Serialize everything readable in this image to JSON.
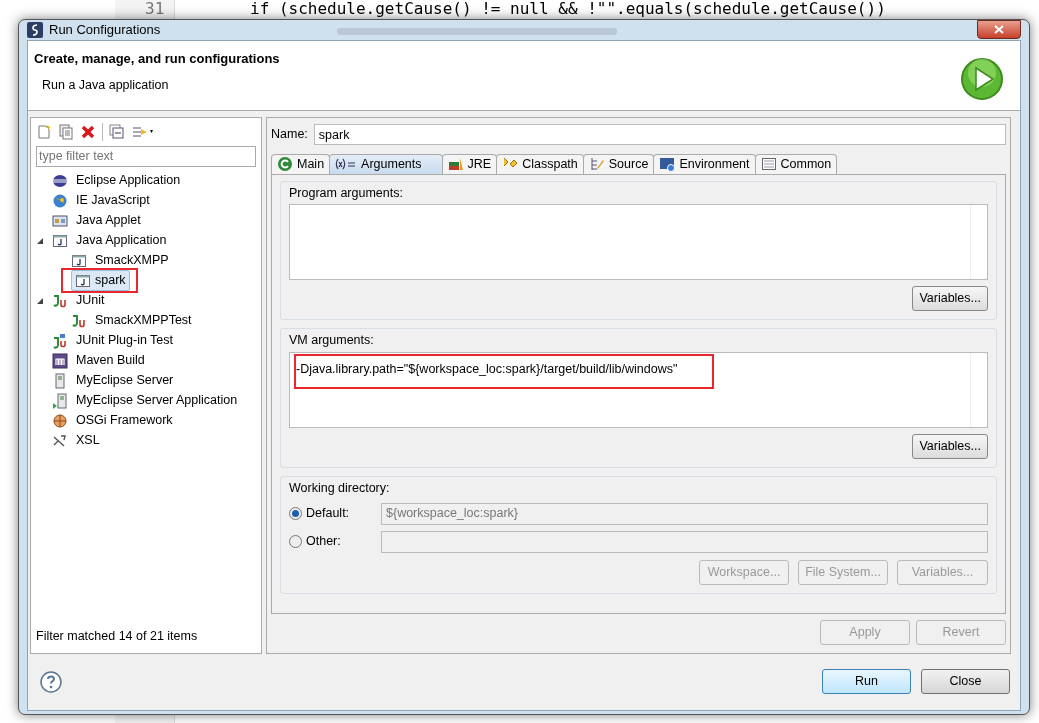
{
  "editor": {
    "line_number": "31",
    "code": "if (schedule.getCause() != null && !\"\".equals(schedule.getCause())"
  },
  "window": {
    "title": "Run Configurations"
  },
  "header": {
    "title": "Create, manage, and run configurations",
    "subtitle": "Run a Java application"
  },
  "filter": {
    "placeholder": "type filter text"
  },
  "tree": [
    {
      "label": "Eclipse Application",
      "selected": false,
      "highlighted": false
    },
    {
      "label": "IE JavaScript",
      "selected": false,
      "highlighted": false
    },
    {
      "label": "Java Applet",
      "selected": false,
      "highlighted": false
    },
    {
      "label": "Java Application",
      "selected": false,
      "highlighted": false,
      "expanded": true,
      "children": [
        {
          "label": "SmackXMPP",
          "selected": false,
          "highlighted": false
        },
        {
          "label": "spark",
          "selected": true,
          "highlighted": true
        }
      ]
    },
    {
      "label": "JUnit",
      "selected": false,
      "highlighted": false,
      "expanded": true,
      "children": [
        {
          "label": "SmackXMPPTest",
          "selected": false,
          "highlighted": false
        }
      ]
    },
    {
      "label": "JUnit Plug-in Test",
      "selected": false,
      "highlighted": false
    },
    {
      "label": "Maven Build",
      "selected": false,
      "highlighted": false
    },
    {
      "label": "MyEclipse Server",
      "selected": false,
      "highlighted": false
    },
    {
      "label": "MyEclipse Server Application",
      "selected": false,
      "highlighted": false
    },
    {
      "label": "OSGi Framework",
      "selected": false,
      "highlighted": false
    },
    {
      "label": "XSL",
      "selected": false,
      "highlighted": false
    }
  ],
  "filter_status": "Filter matched 14 of 21 items",
  "name": {
    "label": "Name:",
    "value": "spark"
  },
  "tabs": [
    {
      "label": "Main",
      "selected": false
    },
    {
      "label": "Arguments",
      "selected": true
    },
    {
      "label": "JRE",
      "selected": false
    },
    {
      "label": "Classpath",
      "selected": false
    },
    {
      "label": "Source",
      "selected": false
    },
    {
      "label": "Environment",
      "selected": false
    },
    {
      "label": "Common",
      "selected": false
    }
  ],
  "program_arguments": {
    "label": "Program arguments:",
    "button": "Variables..."
  },
  "vm_arguments": {
    "label": "VM arguments:",
    "value": "-Djava.library.path=\"${workspace_loc:spark}/target/build/lib/windows\"",
    "highlighted": true,
    "button": "Variables..."
  },
  "working_directory": {
    "label": "Working directory:",
    "options": [
      {
        "label": "Default:",
        "selected": true,
        "value": "${workspace_loc:spark}"
      },
      {
        "label": "Other:",
        "selected": false
      }
    ],
    "buttons": [
      {
        "label": "Workspace...",
        "disabled": true
      },
      {
        "label": "File System...",
        "disabled": true
      },
      {
        "label": "Variables...",
        "disabled": true
      }
    ]
  },
  "apply_buttons": [
    {
      "label": "Apply",
      "disabled": true
    },
    {
      "label": "Revert",
      "disabled": true
    }
  ],
  "footer_buttons": [
    {
      "label": "Run",
      "default": true
    },
    {
      "label": "Close",
      "default": false
    }
  ]
}
